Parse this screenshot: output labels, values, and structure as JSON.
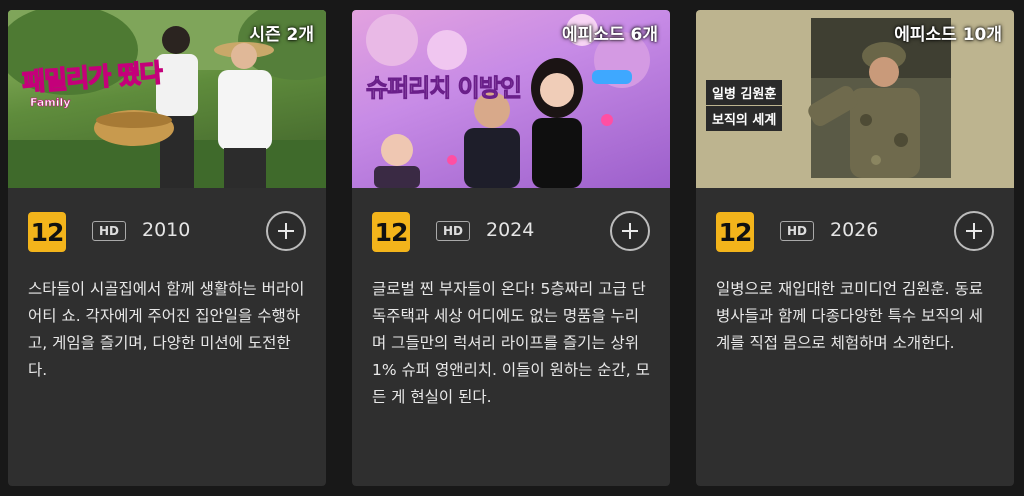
{
  "cards": [
    {
      "badge": "시즌 2개",
      "logo_text": "패밀리가 떴다",
      "logo_sub": "Family",
      "rating": "12",
      "quality": "HD",
      "year": "2010",
      "description": "스타들이 시골집에서 함께 생활하는 버라이어티 쇼. 각자에게 주어진 집안일을 수행하고, 게임을 즐기며, 다양한 미션에 도전한다."
    },
    {
      "badge": "에피소드 6개",
      "logo_text": "슈퍼리치 이방인",
      "rating": "12",
      "quality": "HD",
      "year": "2024",
      "description": "글로벌 찐 부자들이 온다! 5층짜리 고급 단독주택과 세상 어디에도 없는 명품을 누리며 그들만의 럭셔리 라이프를 즐기는 상위 1% 슈퍼 영앤리치. 이들이 원하는 순간, 모든 게 현실이 된다."
    },
    {
      "badge": "에피소드 10개",
      "logo_line1": "일병 김원훈",
      "logo_line2": "보직의 세계",
      "rating": "12",
      "quality": "HD",
      "year": "2026",
      "description": "일병으로 재입대한 코미디언 김원훈. 동료 병사들과 함께 다종다양한 특수 보직의 세계를 직접 몸으로 체험하며 소개한다."
    }
  ],
  "colors": {
    "rating_badge": "#f3b41b",
    "card_bg": "#2f2f2f",
    "page_bg": "#181818"
  },
  "icons": {
    "add": "plus-icon"
  }
}
